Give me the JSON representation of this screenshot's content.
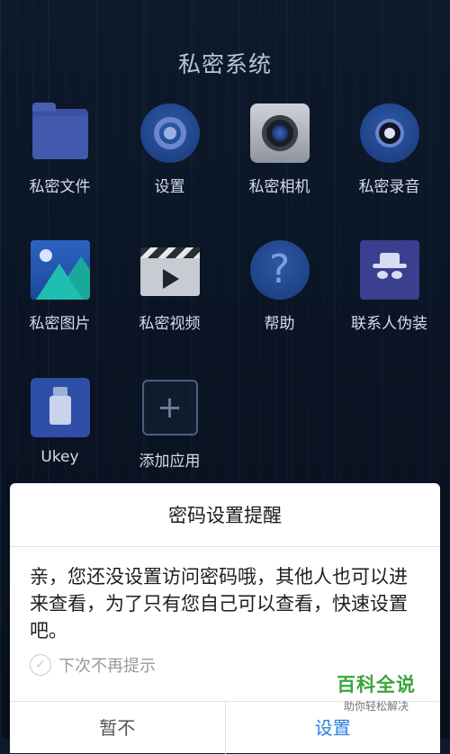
{
  "header": {
    "title": "私密系统"
  },
  "apps": [
    {
      "label": "私密文件",
      "icon": "folder-icon"
    },
    {
      "label": "设置",
      "icon": "gear-icon"
    },
    {
      "label": "私密相机",
      "icon": "camera-icon"
    },
    {
      "label": "私密录音",
      "icon": "recorder-icon"
    },
    {
      "label": "私密图片",
      "icon": "image-icon"
    },
    {
      "label": "私密视频",
      "icon": "video-clapper-icon"
    },
    {
      "label": "帮助",
      "icon": "help-icon"
    },
    {
      "label": "联系人伪装",
      "icon": "spy-icon"
    },
    {
      "label": "Ukey",
      "icon": "usb-icon"
    },
    {
      "label": "添加应用",
      "icon": "add-icon"
    }
  ],
  "dialog": {
    "title": "密码设置提醒",
    "message": "亲，您还没设置访问密码哦，其他人也可以进来查看，为了只有您自己可以查看，快速设置吧。",
    "checkbox_label": "下次不再提示",
    "cancel_label": "暂不",
    "confirm_label": "设置",
    "accent_color": "#2f7fe0"
  },
  "watermark": {
    "main": "百科全说",
    "sub": "助你轻松解决"
  }
}
